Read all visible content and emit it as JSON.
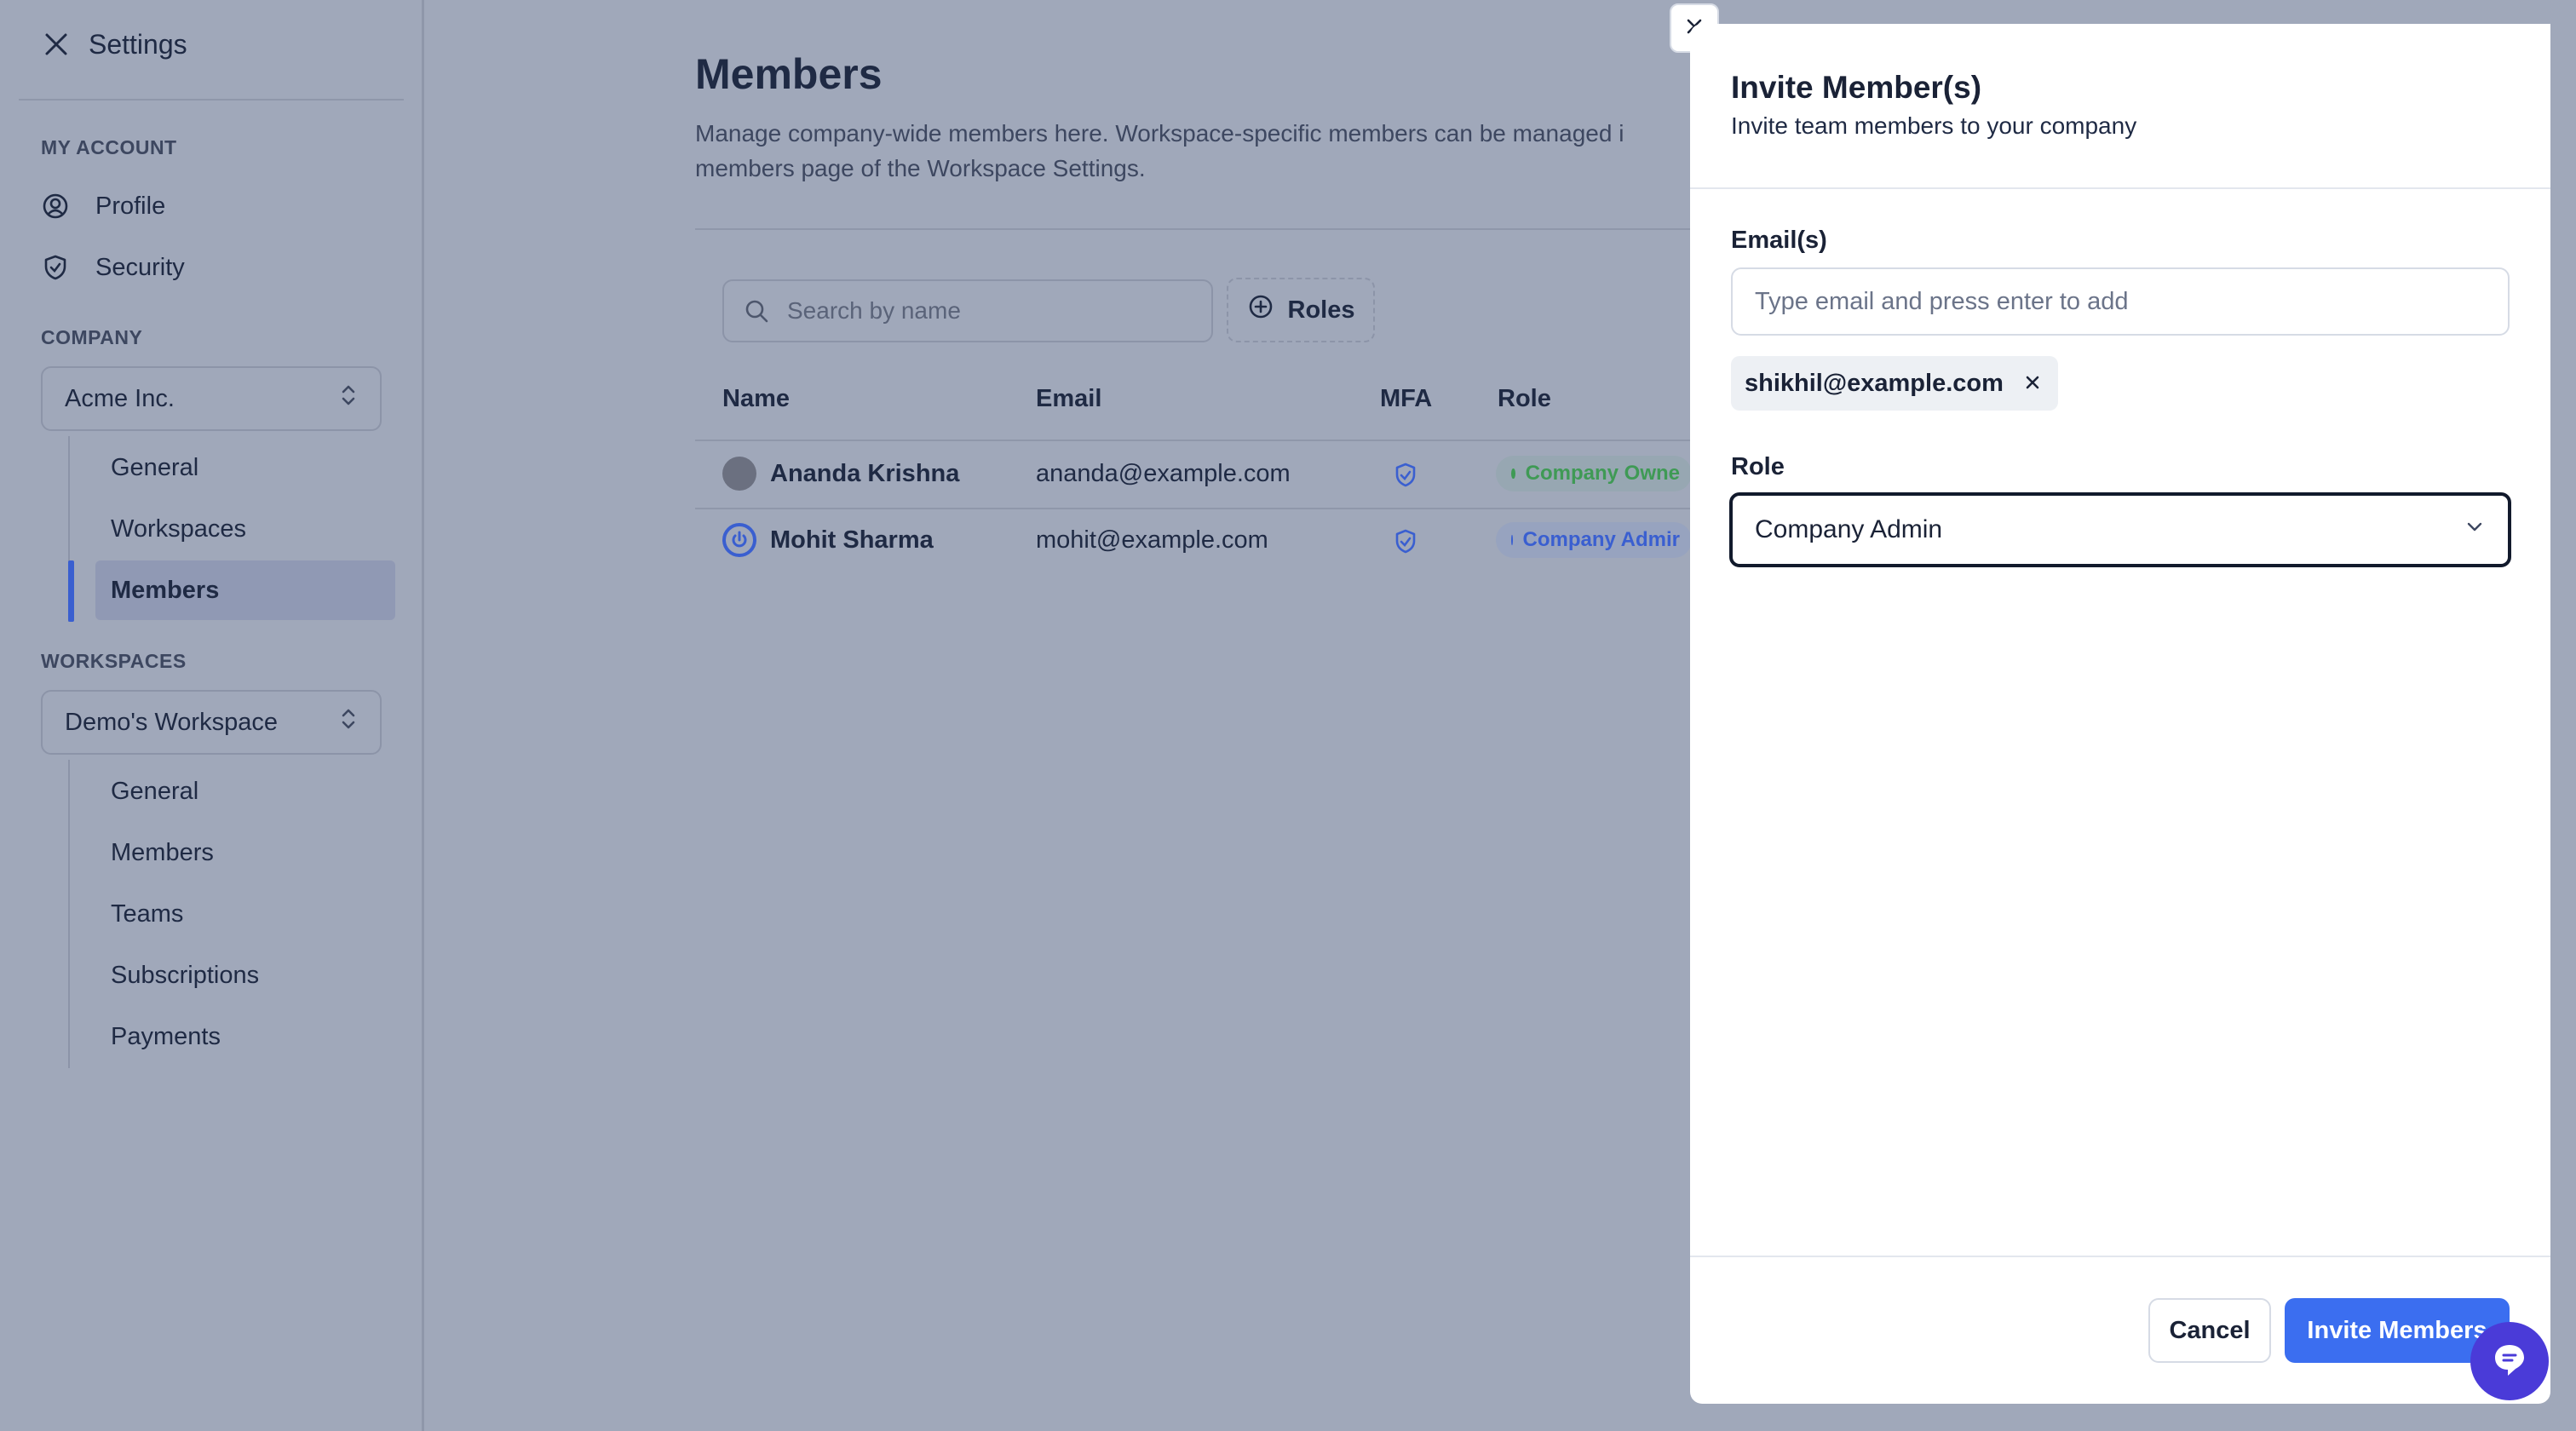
{
  "sidebar": {
    "title": "Settings",
    "my_account_heading": "MY ACCOUNT",
    "profile_label": "Profile",
    "security_label": "Security",
    "company_heading": "COMPANY",
    "company_select": "Acme Inc.",
    "company_items": [
      "General",
      "Workspaces",
      "Members"
    ],
    "workspaces_heading": "WORKSPACES",
    "workspace_select": "Demo's Workspace",
    "workspace_items": [
      "General",
      "Members",
      "Teams",
      "Subscriptions",
      "Payments"
    ]
  },
  "main": {
    "title": "Members",
    "description": "Manage company-wide members here. Workspace-specific members can be managed i\nmembers page of the Workspace Settings.",
    "search_placeholder": "Search by name",
    "roles_button": "Roles",
    "columns": [
      "Name",
      "Email",
      "MFA",
      "Role"
    ],
    "rows": [
      {
        "name": "Ananda Krishna",
        "email": "ananda@example.com",
        "role": "Company Owne",
        "role_color": "#3f9a55"
      },
      {
        "name": "Mohit Sharma",
        "email": "mohit@example.com",
        "role": "Company Admir",
        "role_color": "#3a5fd0"
      }
    ]
  },
  "modal": {
    "title": "Invite Member(s)",
    "subtitle": "Invite team members to your company",
    "emails_label": "Email(s)",
    "email_placeholder": "Type email and press enter to add",
    "email_chips": [
      "shikhil@example.com"
    ],
    "role_label": "Role",
    "role_value": "Company Admin",
    "cancel_button": "Cancel",
    "invite_button": "Invite Members"
  },
  "colors": {
    "accent": "#3b6ef0",
    "overlay": "#a0a8ba",
    "chat_fab": "#4a3bd8"
  }
}
